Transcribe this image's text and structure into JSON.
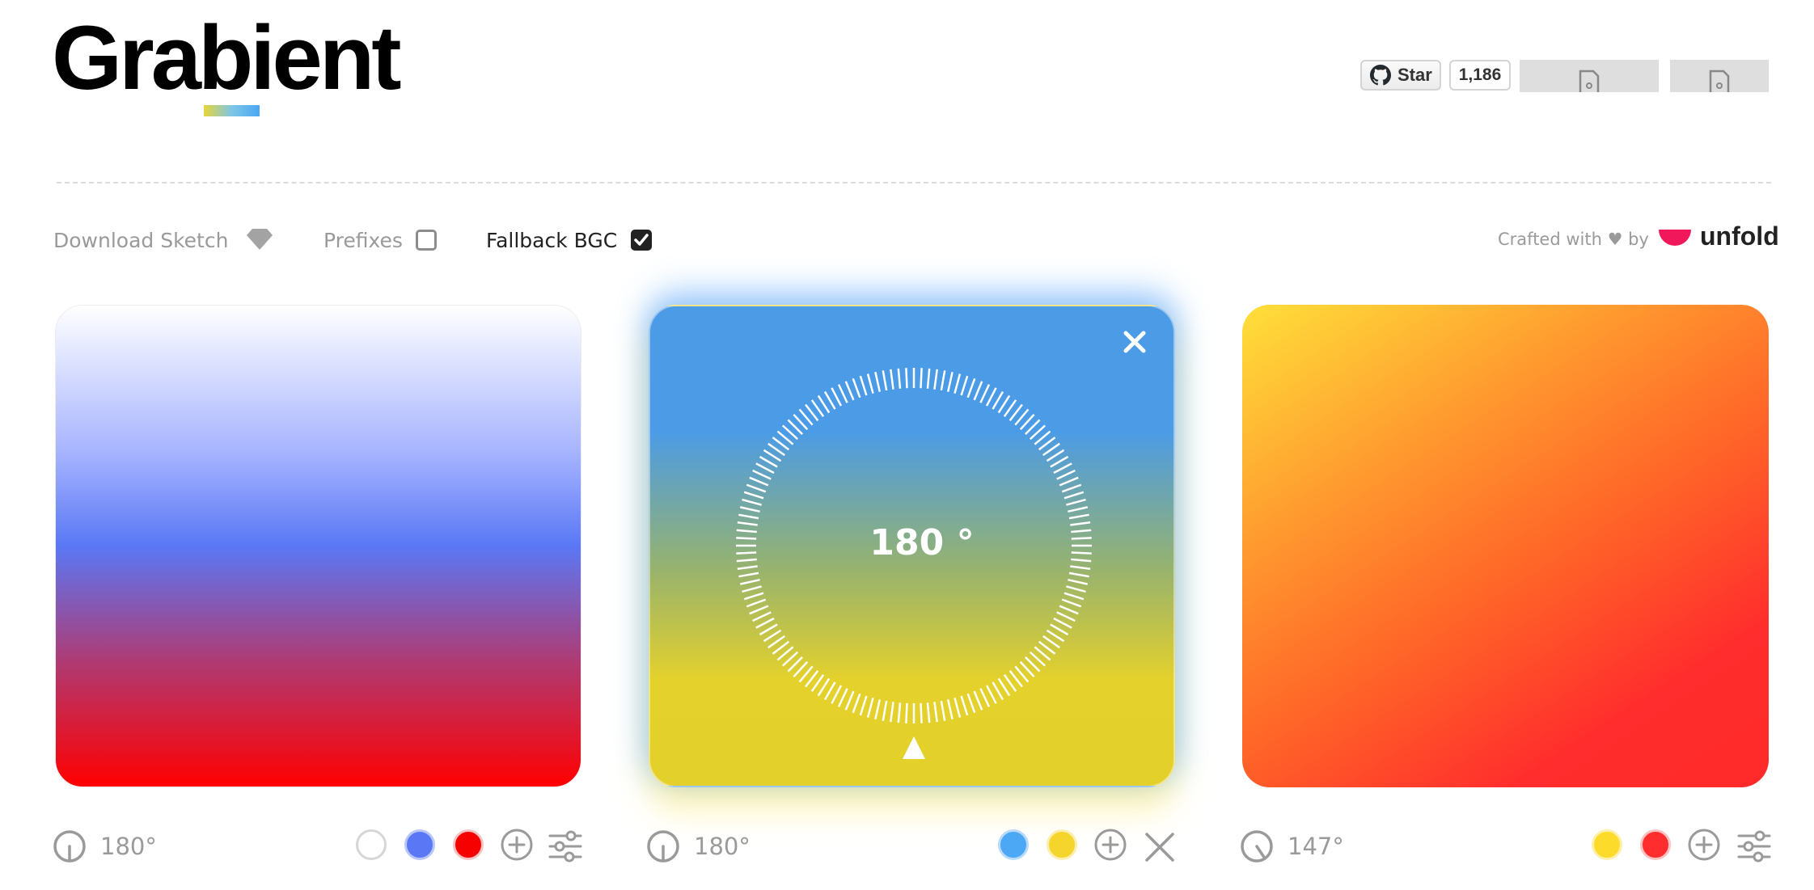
{
  "header": {
    "logo_text": "Grabient",
    "github": {
      "star_label": "Star",
      "star_count": "1,186",
      "icon": "github-icon"
    }
  },
  "options": {
    "download_sketch": "Download Sketch",
    "sketch_icon": "diamond-icon",
    "prefixes": {
      "label": "Prefixes",
      "checked": false
    },
    "fallback_bgc": {
      "label": "Fallback BGC",
      "checked": true
    },
    "credit": "Crafted with ♥ by",
    "brand": "unfold"
  },
  "cards": [
    {
      "angle": "180°",
      "angle_value": 180,
      "stops": [
        "#ffffff",
        "#5a78f5",
        "#ff0000"
      ],
      "controls": [
        "add-stop-icon",
        "sliders-icon"
      ]
    },
    {
      "angle": "180°",
      "angle_value": 180,
      "stops": [
        "#4ca7f5",
        "#f5d52b"
      ],
      "editing": true,
      "dial_readout": "180 °",
      "controls": [
        "add-stop-icon",
        "close-icon"
      ]
    },
    {
      "angle": "147°",
      "angle_value": 147,
      "stops": [
        "#fddb2b",
        "#ff2d2d"
      ],
      "controls": [
        "add-stop-icon",
        "sliders-icon"
      ]
    }
  ],
  "colors": {
    "control_gray": "#9a9a9a",
    "accent_pink": "#f0185a"
  }
}
